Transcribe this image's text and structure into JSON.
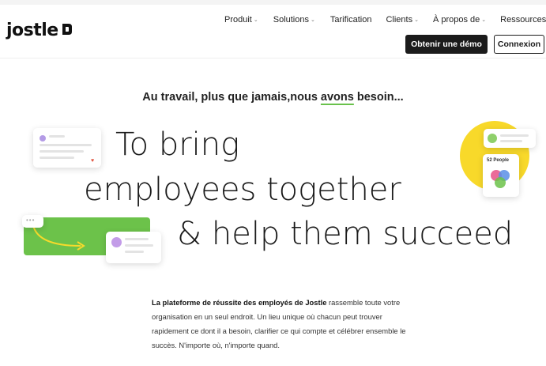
{
  "brand": {
    "name": "jostle"
  },
  "nav": {
    "items": [
      {
        "label": "Produit",
        "has_dropdown": true
      },
      {
        "label": "Solutions",
        "has_dropdown": true
      },
      {
        "label": "Tarification",
        "has_dropdown": false
      },
      {
        "label": "Clients",
        "has_dropdown": true
      },
      {
        "label": "À propos de",
        "has_dropdown": true
      },
      {
        "label": "Ressources",
        "has_dropdown": true
      }
    ],
    "demo_button": "Obtenir une démo",
    "login_button": "Connexion"
  },
  "hero": {
    "tagline_start": "Au travail, plus que jamais,nous ",
    "tagline_underlined": "avons",
    "tagline_end": " besoin...",
    "line1": "To bring",
    "line2": "employees together",
    "line3": "& help them succeed",
    "people_badge": "52 People"
  },
  "description": {
    "bold": "La plateforme de réussite des employés de Jostle",
    "rest": " rassemble toute votre organisation en un seul endroit. Un lieu unique où chacun peut trouver rapidement ce dont il a besoin, clarifier ce qui compte et célébrer ensemble le succès. N'importe où, n'importe quand."
  },
  "colors": {
    "accent_green": "#69c14b",
    "accent_yellow": "#f8d92a",
    "button_dark": "#1b1b1b"
  }
}
